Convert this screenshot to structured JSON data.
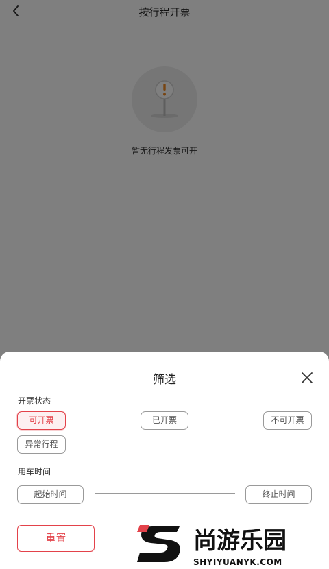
{
  "nav": {
    "title": "按行程开票"
  },
  "empty": {
    "message": "暂无行程发票可开"
  },
  "filter": {
    "title": "筛选",
    "status_section_label": "开票状态",
    "status_options": [
      "可开票",
      "已开票",
      "不可开票",
      "异常行程"
    ],
    "selected_status": "可开票",
    "time_section_label": "用车时间",
    "start_time_placeholder": "起始时间",
    "end_time_placeholder": "终止时间",
    "reset_label": "重置",
    "confirm_label": ""
  },
  "watermark": {
    "brand_cn": "尚游乐园",
    "brand_en": "SHYIYUANYK.COM"
  },
  "colors": {
    "accent": "#e3424a",
    "overlay": "rgba(0,0,0,0.5)"
  }
}
